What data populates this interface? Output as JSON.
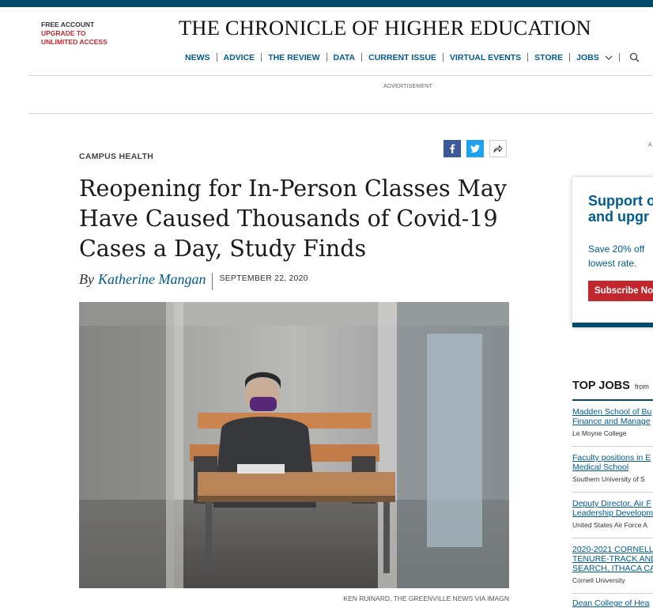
{
  "header": {
    "account": {
      "free": "FREE ACCOUNT",
      "upgrade1": "UPGRADE TO",
      "upgrade2": "UNLIMITED ACCESS"
    },
    "masthead": "THE CHRONICLE OF HIGHER EDUCATION",
    "nav": [
      "NEWS",
      "ADVICE",
      "THE REVIEW",
      "DATA",
      "CURRENT ISSUE",
      "VIRTUAL EVENTS",
      "STORE",
      "JOBS"
    ],
    "nav_icons": {
      "dropdown": "chevron-down-icon",
      "search": "search-icon"
    },
    "ad_label": "ADVERTISEMENT"
  },
  "article": {
    "kicker": "CAMPUS HEALTH",
    "headline": "Reopening for In-Person Classes May Have Caused Thousands of Covid-19 Cases a Day, Study Finds",
    "by": "By",
    "author": "Katherine Mangan",
    "date": "SEPTEMBER 22, 2020",
    "photo_credit": "KEN RUINARD, THE GREENVILLE NEWS VIA IMAGN",
    "share_icons": [
      "facebook-icon",
      "twitter-icon",
      "share-icon"
    ]
  },
  "sidebar": {
    "ad_letter": "A",
    "subscribe": {
      "heading1": "Support o",
      "heading2": "and upgr",
      "body1": "Save 20% off",
      "body2": "lowest rate.",
      "button": "Subscribe No"
    },
    "top_jobs": {
      "title": "TOP JOBS",
      "from": "from",
      "jobs": [
        {
          "t1": "Madden School of Bu",
          "t2": "Finance and Manage",
          "t3": "",
          "org": "Le Moyne College"
        },
        {
          "t1": "Faculty positions in E",
          "t2": "Medical School",
          "t3": "",
          "org": "Southern University of S"
        },
        {
          "t1": "Deputy Director, Air F",
          "t2": "Leadership Developm",
          "t3": "",
          "org": "United States Air Force A"
        },
        {
          "t1": "2020-2021 CORNELL",
          "t2": "TENURE-TRACK AND",
          "t3": "SEARCH, ITHACA CA",
          "org": "Cornell University"
        },
        {
          "t1": "Dean College of Hea",
          "t2": "",
          "t3": "",
          "org": ""
        }
      ]
    }
  },
  "colors": {
    "brand_blue": "#005b8f",
    "navy": "#004a6b",
    "red": "#c0282d"
  }
}
